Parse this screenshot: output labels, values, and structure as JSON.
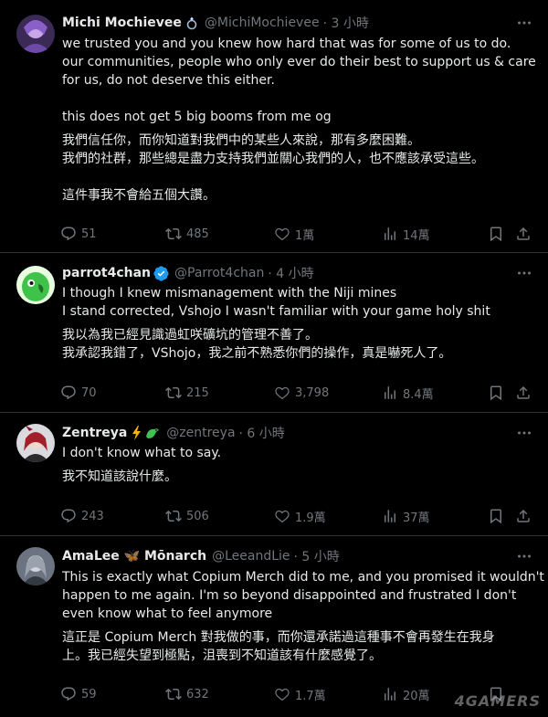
{
  "tweets": [
    {
      "name": "Michi Mochievee",
      "badge_icon": "ring-icon",
      "handle": "@MichiMochievee",
      "time": "· 3 小時",
      "lines": [
        "we trusted you and you knew how hard that was for some of us to do.",
        "our communities, people who only ever do their best to support us & care",
        "for us, do not deserve this either.",
        "",
        "this does not get 5 big booms from me og",
        "我們信任你，而你知道對我們中的某些人來說，那有多麼困難。",
        "我們的社群，那些總是盡力支持我們並關心我們的人，也不應該承受這些。",
        "",
        "這件事我不會給五個大讚。"
      ],
      "stats": {
        "replies": "51",
        "reposts": "485",
        "likes": "1萬",
        "views": "14萬"
      }
    },
    {
      "name": "parrot4chan",
      "badge_icon": "verified-badge-icon",
      "handle": "@Parrot4chan",
      "time": "· 4 小時",
      "lines": [
        "I though I knew mismanagement with the Niji mines",
        "I stand corrected, Vshojo I wasn't familiar with your game holy shit",
        "我以為我已經見識過虹咲礦坑的管理不善了。",
        "我承認我錯了，VShojo，我之前不熟悉你們的操作，真是嚇死人了。"
      ],
      "stats": {
        "replies": "70",
        "reposts": "215",
        "likes": "3,798",
        "views": "8.4萬"
      }
    },
    {
      "name": "Zentreya",
      "badge_icon": "lightning-dragon-emoji-icon",
      "handle": "@zentreya",
      "time": "· 6 小時",
      "lines": [
        "I don't know what to say.",
        "我不知道該說什麼。"
      ],
      "stats": {
        "replies": "243",
        "reposts": "506",
        "likes": "1.9萬",
        "views": "37萬"
      }
    },
    {
      "name": "AmaLee 🦋 Mōnarch",
      "badge_icon": "butterfly-icon",
      "handle": "@LeeandLie",
      "time": "· 5 小時",
      "lines": [
        "This is exactly what Copium Merch did to me, and you promised it wouldn't",
        "happen to me again. I'm so beyond disappointed and frustrated I don't",
        "even know what to feel anymore",
        "這正是 Copium Merch 對我做的事，而你還承諾過這種事不會再發生在我身",
        "上。我已經失望到極點，沮喪到不知道該有什麼感覺了。"
      ],
      "stats": {
        "replies": "59",
        "reposts": "632",
        "likes": "1.7萬",
        "views": "20萬"
      }
    }
  ],
  "watermark": "4GAMERS",
  "colors": {
    "background": "#000000",
    "text": "#e7e9ea",
    "muted": "#71767b",
    "divider": "#2f3336",
    "verified": "#1d9bf0"
  }
}
